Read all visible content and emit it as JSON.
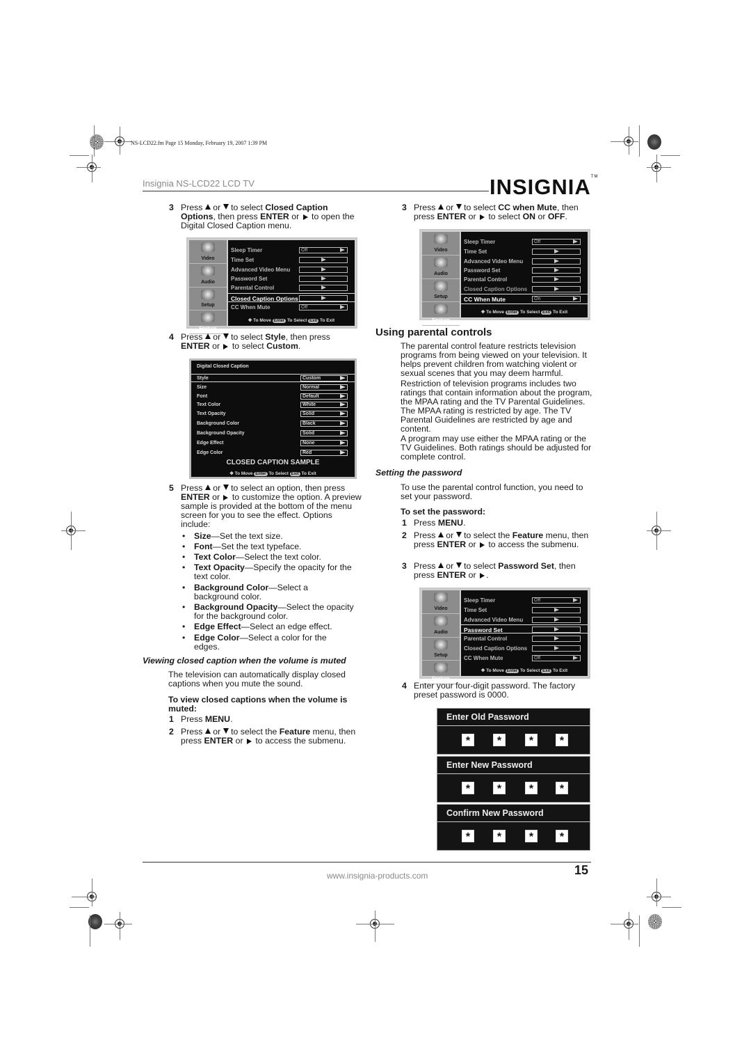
{
  "file_info": "NS-LCD22.fm  Page 15  Monday, February 19, 2007  1:39 PM",
  "header": {
    "title": "Insignia NS-LCD22 LCD TV",
    "logo": "INSIGNIA",
    "logo_tm": "TM"
  },
  "footer": {
    "url": "www.insignia-products.com",
    "page_number": "15"
  },
  "left": {
    "step3": {
      "num": "3",
      "t1": "Press",
      "t2": "or",
      "t3": "to select",
      "b1": "Closed Caption Options",
      "t4": ", then press",
      "b2": "ENTER",
      "t5": "or",
      "t6": "to open the Digital Closed Caption menu."
    },
    "menu1": {
      "side": [
        "Video",
        "Audio",
        "Setup",
        "Feature"
      ],
      "rows": [
        {
          "label": "Sleep Timer",
          "value": "Off"
        },
        {
          "label": "Time Set",
          "value": ""
        },
        {
          "label": "Advanced Video Menu",
          "value": ""
        },
        {
          "label": "Password Set",
          "value": ""
        },
        {
          "label": "Parental Control",
          "value": ""
        },
        {
          "label": "Closed Caption Options",
          "value": "",
          "selected": true
        },
        {
          "label": "CC When Mute",
          "value": "Off"
        }
      ],
      "hint": {
        "move": "To Move",
        "enter_key": "Enter",
        "select": "To Select",
        "exit_key": "Exit",
        "exit": "To Exit"
      }
    },
    "step4": {
      "num": "4",
      "t1": "Press",
      "t2": "or",
      "t3": "to select",
      "b1": "Style",
      "t4": ", then press",
      "b2": "ENTER",
      "t5": "or",
      "t6": "to select",
      "b3": "Custom",
      "t7": "."
    },
    "ccmenu": {
      "title": "Digital Closed Caption",
      "rows": [
        {
          "label": "Style",
          "value": "Custom",
          "selected": true
        },
        {
          "label": "Size",
          "value": "Normal"
        },
        {
          "label": "Font",
          "value": "Default"
        },
        {
          "label": "Text Color",
          "value": "White"
        },
        {
          "label": "Text Opacity",
          "value": "Solid"
        },
        {
          "label": "Background Color",
          "value": "Black"
        },
        {
          "label": "Background Opacity",
          "value": "Solid"
        },
        {
          "label": "Edge Effect",
          "value": "None"
        },
        {
          "label": "Edge Color",
          "value": "Red"
        }
      ],
      "sample": "CLOSED CAPTION SAMPLE",
      "hint": {
        "move": "To Move",
        "enter_key": "Enter",
        "select": "To Select",
        "exit_key": "Exit",
        "exit": "To Exit"
      }
    },
    "step5": {
      "num": "5",
      "t1": "Press",
      "t2": "or",
      "t3": "to select an option, then press",
      "b1": "ENTER",
      "t4": "or",
      "t5": "to customize the option. A preview sample is provided at the bottom of the menu screen for you to see the effect. Options include:"
    },
    "options": [
      {
        "term": "Size",
        "desc": "—Set the text size."
      },
      {
        "term": "Font",
        "desc": "—Set the text typeface."
      },
      {
        "term": "Text Color",
        "desc": "—Select the text color."
      },
      {
        "term": "Text Opacity",
        "desc": "—Specify the opacity for the text color."
      },
      {
        "term": "Background Color",
        "desc": "—Select a background color."
      },
      {
        "term": "Background Opacity",
        "desc": "—Select the opacity for the background color."
      },
      {
        "term": "Edge Effect",
        "desc": "—Select an edge effect."
      },
      {
        "term": "Edge Color",
        "desc": "—Select a color for the edges."
      }
    ],
    "muted_heading": "Viewing closed caption when the volume is muted",
    "muted_para": "The television can automatically display closed captions when you mute the sound.",
    "muted_proc": "To view closed captions when the volume is muted:",
    "m_step1": {
      "num": "1",
      "t1": "Press",
      "b1": "MENU",
      "t2": "."
    },
    "m_step2": {
      "num": "2",
      "t1": "Press",
      "t2": "or",
      "t3": "to select the",
      "b1": "Feature",
      "t4": "menu, then press",
      "b2": "ENTER",
      "t5": "or",
      "t6": "to access the submenu."
    }
  },
  "right": {
    "step3": {
      "num": "3",
      "t1": "Press",
      "t2": "or",
      "t3": "to select",
      "b1": "CC when Mute",
      "t4": ", then press",
      "b2": "ENTER",
      "t5": "or",
      "t6": "to select",
      "b3": "ON",
      "t7": "or",
      "b4": "OFF",
      "t8": "."
    },
    "menu2": {
      "side": [
        "Video",
        "Audio",
        "Setup",
        "Feature"
      ],
      "rows": [
        {
          "label": "Sleep Timer",
          "value": "Off"
        },
        {
          "label": "Time Set",
          "value": ""
        },
        {
          "label": "Advanced Video Menu",
          "value": ""
        },
        {
          "label": "Password Set",
          "value": ""
        },
        {
          "label": "Parental Control",
          "value": ""
        },
        {
          "label": "Closed Caption Options",
          "value": ""
        },
        {
          "label": "CC When Mute",
          "value": "On",
          "selected": true
        }
      ],
      "hint": {
        "move": "To Move",
        "enter_key": "Enter",
        "select": "To Select",
        "exit_key": "Exit",
        "exit": "To Exit"
      }
    },
    "parental_heading": "Using parental controls",
    "par1": "The parental control feature restricts television programs from being viewed on your television. It helps prevent children from watching violent or sexual scenes that you may deem harmful.",
    "par2": "Restriction of television programs includes two ratings that contain information about the program, the MPAA rating and the TV Parental Guidelines. The MPAA rating is restricted by age. The TV Parental Guidelines are restricted by age and content.",
    "par3": "A program may use either the MPAA rating or the TV Guidelines. Both ratings should be adjusted for complete control.",
    "pw_heading": "Setting the password",
    "pw_para": "To use the parental control function, you need to set your password.",
    "pw_proc": "To set the password:",
    "p_step1": {
      "num": "1",
      "t1": "Press",
      "b1": "MENU",
      "t2": "."
    },
    "p_step2": {
      "num": "2",
      "t1": "Press",
      "t2": "or",
      "t3": "to select the",
      "b1": "Feature",
      "t4": "menu, then press",
      "b2": "ENTER",
      "t5": "or",
      "t6": "to access the submenu."
    },
    "p_step3": {
      "num": "3",
      "t1": "Press",
      "t2": "or",
      "t3": "to select",
      "b1": "Password Set",
      "t4": ", then press",
      "b2": "ENTER",
      "t5": "or",
      "t6": "."
    },
    "menu3": {
      "side": [
        "Video",
        "Audio",
        "Setup",
        "Feature"
      ],
      "rows": [
        {
          "label": "Sleep Timer",
          "value": "Off"
        },
        {
          "label": "Time Set",
          "value": ""
        },
        {
          "label": "Advanced Video Menu",
          "value": ""
        },
        {
          "label": "Password Set",
          "value": "",
          "selected": true
        },
        {
          "label": "Parental Control",
          "value": ""
        },
        {
          "label": "Closed Caption Options",
          "value": ""
        },
        {
          "label": "CC When Mute",
          "value": "Off"
        }
      ],
      "hint": {
        "move": "To Move",
        "enter_key": "Enter",
        "select": "To Select",
        "exit_key": "Exit",
        "exit": "To Exit"
      }
    },
    "p_step4": {
      "num": "4",
      "text": "Enter your four-digit password. The factory preset password is 0000."
    },
    "password_boxes": [
      {
        "title": "Enter Old Password",
        "digits": [
          "*",
          "*",
          "*",
          "*"
        ]
      },
      {
        "title": "Enter New Password",
        "digits": [
          "*",
          "*",
          "*",
          "*"
        ]
      },
      {
        "title": "Confirm New Password",
        "digits": [
          "*",
          "*",
          "*",
          "*"
        ]
      }
    ]
  }
}
